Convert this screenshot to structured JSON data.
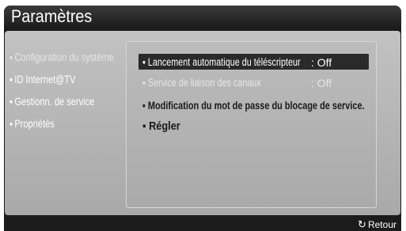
{
  "window": {
    "title": "Paramètres"
  },
  "sidebar": {
    "bullet": "▪",
    "items": [
      {
        "label": "Configuration du système"
      },
      {
        "label": "ID Internet@TV"
      },
      {
        "label": "Gestionn. de service"
      },
      {
        "label": "Propriétés"
      }
    ]
  },
  "options": [
    {
      "label": "Lancement automatique du téléscripteur",
      "value": ": Off",
      "state": "selected"
    },
    {
      "label": "Service de liaison des canaux",
      "value": ": Off",
      "state": "disabled"
    },
    {
      "label": "Modification du mot de passe du blocage de service.",
      "state": "normal"
    },
    {
      "label": "Régler",
      "state": "normal"
    }
  ],
  "footer": {
    "return_icon": "return-arrow-icon",
    "return_label": "Retour"
  }
}
